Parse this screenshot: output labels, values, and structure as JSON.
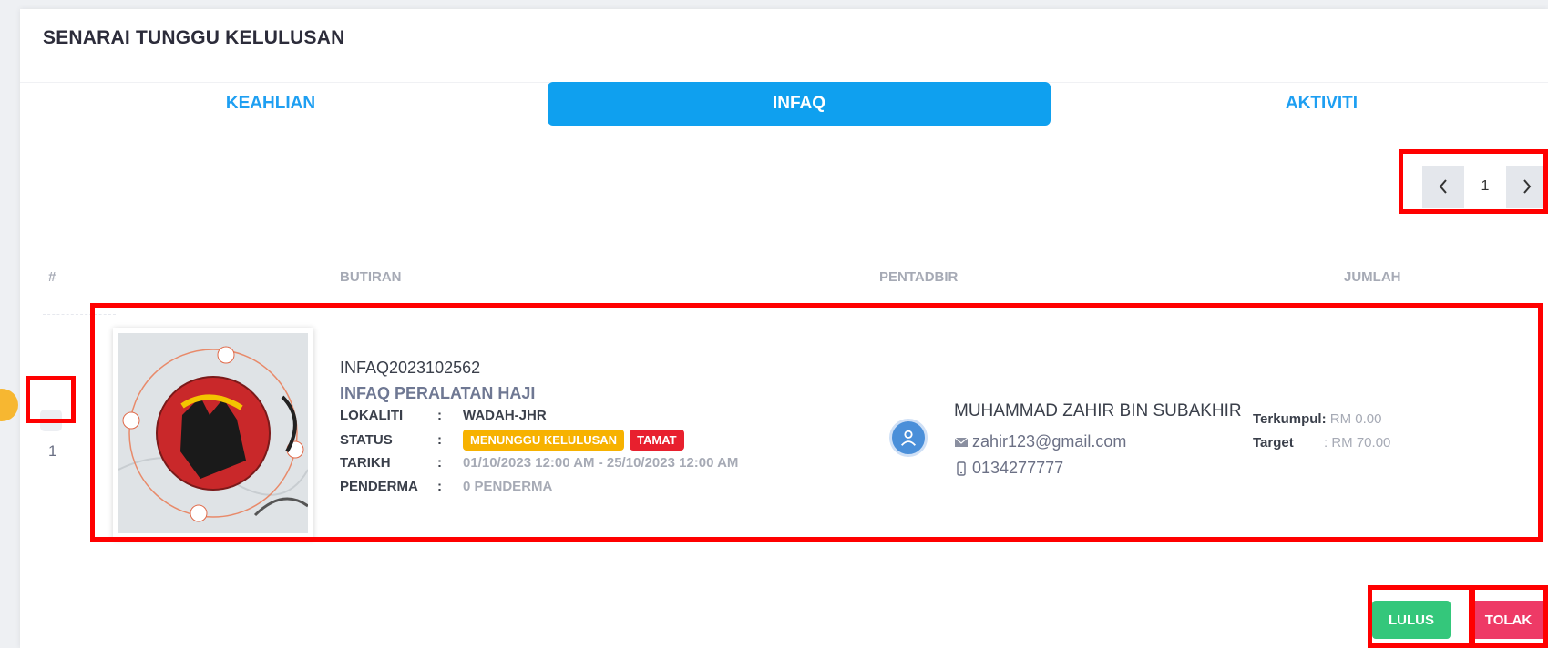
{
  "page": {
    "title": "SENARAI TUNGGU KELULUSAN"
  },
  "tabs": [
    {
      "label": "KEAHLIAN",
      "active": false
    },
    {
      "label": "INFAQ",
      "active": true
    },
    {
      "label": "AKTIVITI",
      "active": false
    }
  ],
  "pagination": {
    "current_page": "1",
    "prev_icon": "chevron-left-icon",
    "next_icon": "chevron-right-icon"
  },
  "table": {
    "headers": {
      "index": "#",
      "details": "BUTIRAN",
      "admin": "PENTADBIR",
      "amount": "JUMLAH"
    },
    "rows": [
      {
        "index": "1",
        "code": "INFAQ2023102562",
        "name": "INFAQ PERALATAN HAJI",
        "fields": {
          "lokaliti_label": "LOKALITI",
          "lokaliti_value": "WADAH-JHR",
          "status_label": "STATUS",
          "status_badges": [
            "MENUNGGU KELULUSAN",
            "TAMAT"
          ],
          "tarikh_label": "TARIKH",
          "tarikh_value": "01/10/2023 12:00 AM - 25/10/2023 12:00 AM",
          "penderma_label": "PENDERMA",
          "penderma_value": "0 PENDERMA",
          "separator": ":"
        },
        "admin": {
          "name": "MUHAMMAD ZAHIR BIN SUBAKHIR",
          "email": "zahir123@gmail.com",
          "phone": "0134277777"
        },
        "amount": {
          "collected_label": "Terkumpul:",
          "collected_value": "RM 0.00",
          "target_label": "Target",
          "target_sep": ":",
          "target_value": "RM 70.00"
        }
      }
    ]
  },
  "actions": {
    "approve_label": "LULUS",
    "reject_label": "TOLAK"
  },
  "colors": {
    "tab_active": "#0fa0ef",
    "badge_pending": "#f7b200",
    "badge_ended": "#e8202e",
    "approve": "#34c77b",
    "reject": "#ee3a66",
    "highlight": "#ff0000"
  }
}
